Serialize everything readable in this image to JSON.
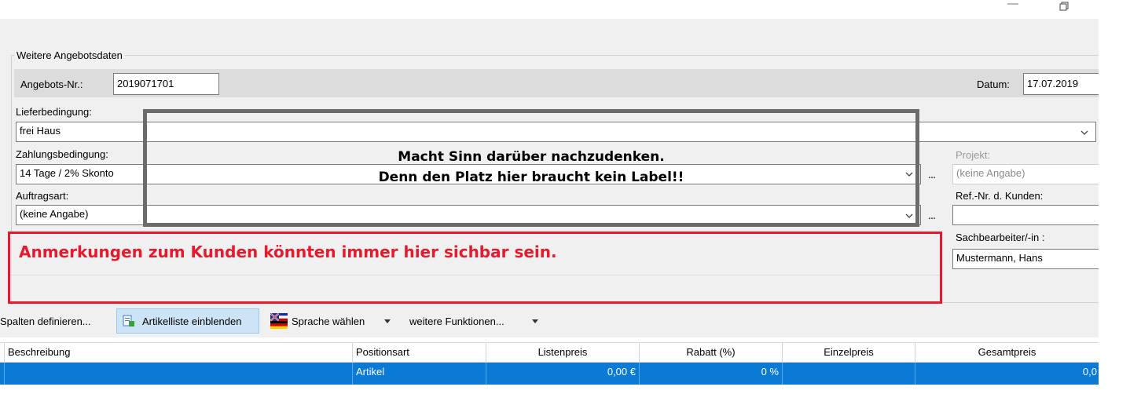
{
  "group": {
    "title": "Weitere Angebotsdaten"
  },
  "angebot": {
    "label": "Angebots-Nr.:",
    "value": "2019071701"
  },
  "datum": {
    "label": "Datum:",
    "value": "17.07.2019"
  },
  "liefer": {
    "label": "Lieferbedingung:",
    "value": "frei Haus"
  },
  "zahlung": {
    "label": "Zahlungsbedingung:",
    "value": "14 Tage / 2% Skonto"
  },
  "auftrag": {
    "label": "Auftragsart:",
    "value": "(keine Angabe)"
  },
  "projekt": {
    "label": "Projekt:",
    "value": "(keine Angabe)"
  },
  "refnr": {
    "label": "Ref.-Nr. d. Kunden:",
    "value": ""
  },
  "sachbearbeiter": {
    "label": "Sachbearbeiter/-in :",
    "value": "Mustermann, Hans"
  },
  "buttons": {
    "dots": "..."
  },
  "annotations": {
    "grey_line1": "Macht Sinn darüber nachzudenken.",
    "grey_line2": "Denn den Platz hier braucht kein Label!!",
    "red": "Anmerkungen zum Kunden könnten immer hier sichbar sein."
  },
  "toolbar": {
    "spalten": "Spalten definieren...",
    "artikelliste": "Artikelliste einblenden",
    "sprache": "Sprache wählen",
    "weitere": "weitere Funktionen..."
  },
  "grid": {
    "headers": [
      "Beschreibung",
      "Positionsart",
      "Listenpreis",
      "Rabatt (%)",
      "Einzelpreis",
      "Gesamtpreis"
    ],
    "row": {
      "beschreibung": "",
      "positionsart": "Artikel",
      "listenpreis": "0,00 €",
      "rabatt": "0 %",
      "einzelpreis": "",
      "gesamtpreis": "0,0"
    }
  },
  "colors": {
    "selection": "#0a7ad4",
    "annotation_red": "#e8192c",
    "annotation_grey": "#6b6b6b",
    "panel": "#f0f0f0"
  },
  "icons": [
    "minimize-icon",
    "restore-icon",
    "chevron-down-icon",
    "artikelliste-icon",
    "flag-icon"
  ]
}
